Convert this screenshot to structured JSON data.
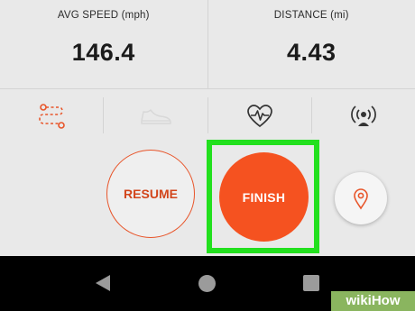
{
  "stats": [
    {
      "label": "AVG SPEED  (mph)",
      "value": "146.4"
    },
    {
      "label": "DISTANCE  (mi)",
      "value": "4.43"
    }
  ],
  "sensors": [
    {
      "icon": "route-icon",
      "color": "#e8552a"
    },
    {
      "icon": "shoe-icon",
      "color": "#d8d8d8"
    },
    {
      "icon": "heart-rate-icon",
      "color": "#333333"
    },
    {
      "icon": "sensor-broadcast-icon",
      "color": "#333333"
    }
  ],
  "controls": {
    "resume_label": "RESUME",
    "finish_label": "FINISH",
    "location_icon": "map-pin-icon",
    "accent": "#f55220",
    "highlight": "#22e01e"
  },
  "navbar": {
    "back_icon": "back-icon",
    "home_icon": "home-icon",
    "recents_icon": "recents-icon"
  },
  "watermark": {
    "text": "wikiHow"
  }
}
